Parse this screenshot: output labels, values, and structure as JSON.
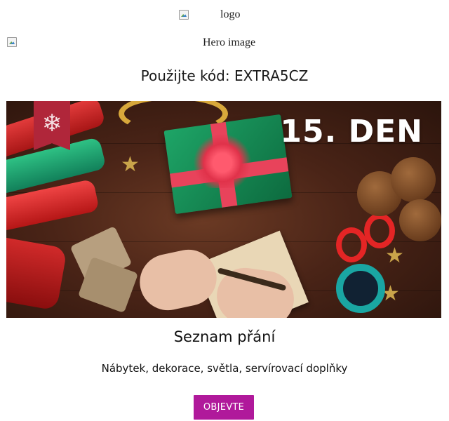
{
  "logo": {
    "alt": "logo"
  },
  "hero": {
    "alt": "Hero image"
  },
  "promo": {
    "code_text": "Použijte kód: EXTRA5CZ"
  },
  "banner": {
    "day_label": "15. DEN",
    "badge_icon": "snowflake-icon"
  },
  "section": {
    "title": "Seznam přání",
    "subtitle": "Nábytek, dekorace, světla, servírovací doplňky",
    "cta_label": "OBJEVTE"
  },
  "colors": {
    "cta_bg": "#b0199b",
    "badge": "#b0263a"
  }
}
